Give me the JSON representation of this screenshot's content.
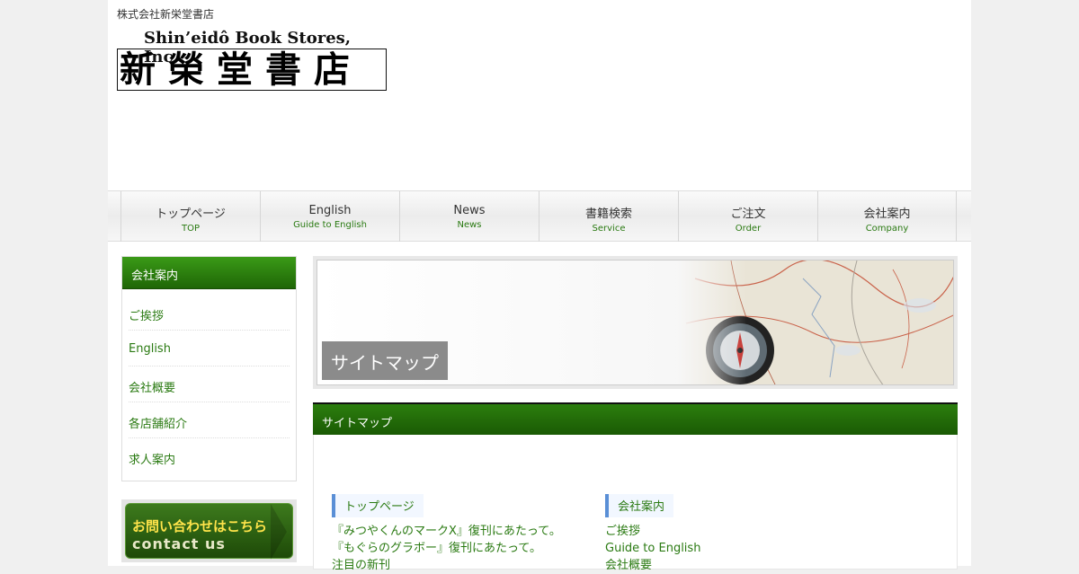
{
  "header": {
    "tagline": "株式会社新栄堂書店",
    "logo_en": "Shin’eidô Book Stores, Inc.",
    "logo_jp": "新榮堂書店"
  },
  "nav": [
    {
      "main": "トップページ",
      "sub": "TOP"
    },
    {
      "main": "English",
      "sub": "Guide to English"
    },
    {
      "main": "News",
      "sub": "News"
    },
    {
      "main": "書籍検索",
      "sub": "Service"
    },
    {
      "main": "ご注文",
      "sub": "Order"
    },
    {
      "main": "会社案内",
      "sub": "Company"
    }
  ],
  "sidebar": {
    "title": "会社案内",
    "items": [
      "ご挨拶",
      "English",
      "会社概要",
      "各店舗紹介",
      "求人案内"
    ]
  },
  "contact_banner": {
    "jp": "お問い合わせはこちら",
    "en": "contact us"
  },
  "hero": {
    "label": "サイトマップ"
  },
  "section": {
    "title": "サイトマップ"
  },
  "sitemap": {
    "left": {
      "heading": "トップページ",
      "links": [
        "『みつやくんのマークⅩ』復刊にあたって。",
        "『もぐらのグラボー』復刊にあたって。",
        "注目の新刊"
      ]
    },
    "right": {
      "heading": "会社案内",
      "links": [
        "ご挨拶",
        "Guide to English",
        "会社概要"
      ]
    }
  },
  "colors": {
    "accent_green": "#2a7a12",
    "bar_green": "#1f6606",
    "heading_marker": "#5a8fd6"
  }
}
